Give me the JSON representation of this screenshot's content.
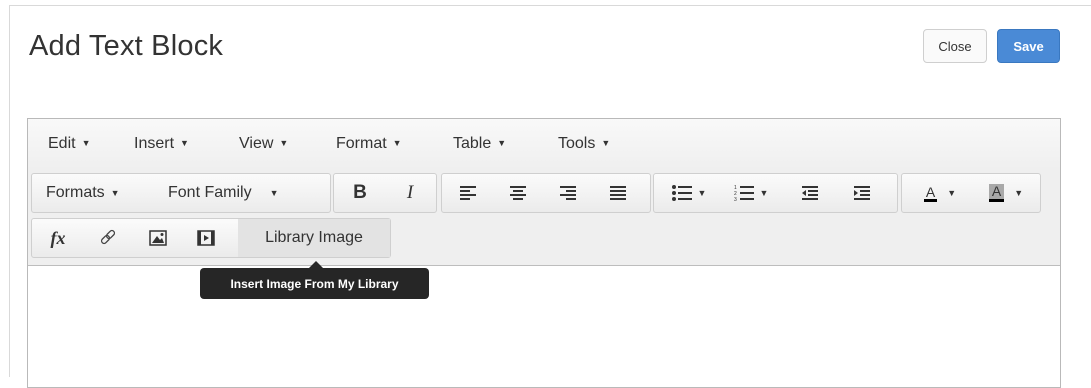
{
  "header": {
    "title": "Add Text Block",
    "close_label": "Close",
    "save_label": "Save"
  },
  "menubar": {
    "edit": "Edit",
    "insert": "Insert",
    "view": "View",
    "format": "Format",
    "table": "Table",
    "tools": "Tools"
  },
  "toolbar": {
    "formats": "Formats",
    "font_family": "Font Family",
    "bold": "B",
    "italic": "I",
    "text_color": "A",
    "bg_color": "A",
    "fx": "fx",
    "library_image": "Library Image"
  },
  "tooltip": {
    "text": "Insert Image From My Library"
  },
  "colors": {
    "save_button": "#4a8ad6",
    "tooltip_bg": "#262626",
    "text_color_underline": "#000000",
    "bg_color_fill": "#a9a9a9"
  }
}
